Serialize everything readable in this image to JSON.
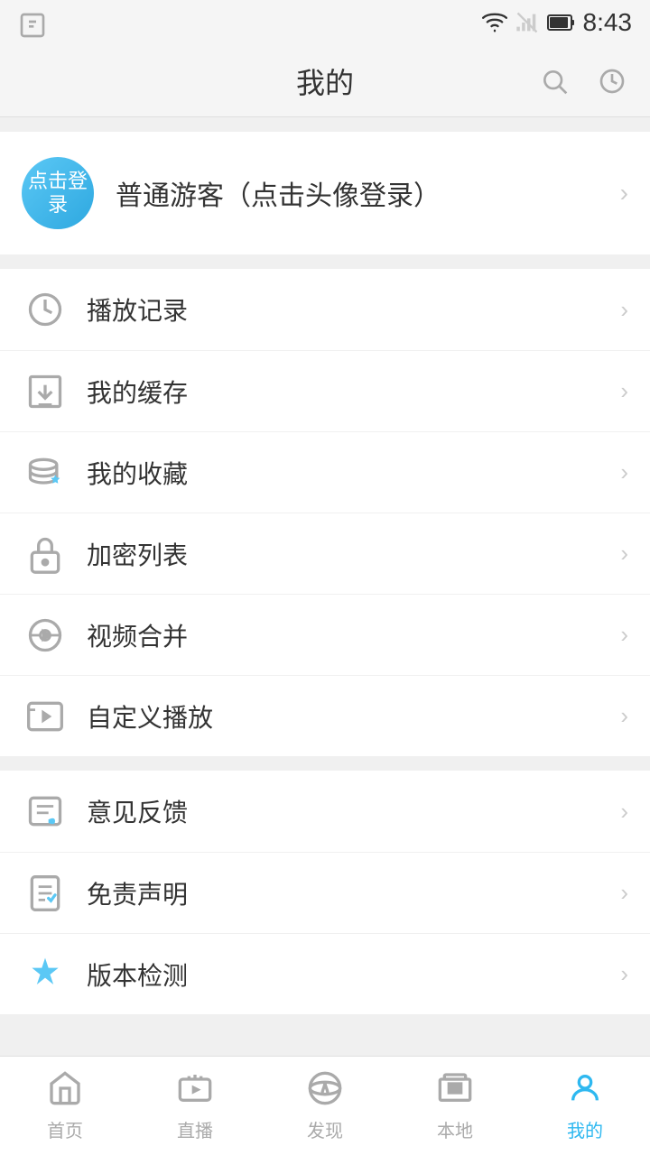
{
  "statusBar": {
    "time": "8:43",
    "wifiIcon": "wifi",
    "signalIcon": "signal",
    "batteryIcon": "battery"
  },
  "header": {
    "title": "我的",
    "searchLabel": "搜索",
    "historyLabel": "历史"
  },
  "profile": {
    "avatarText": "点击登录",
    "name": "普通游客（点击头像登录）"
  },
  "menuGroups": [
    {
      "id": "group1",
      "items": [
        {
          "id": "play-history",
          "icon": "clock",
          "label": "播放记录"
        },
        {
          "id": "my-cache",
          "icon": "download",
          "label": "我的缓存"
        },
        {
          "id": "my-favorites",
          "icon": "star-db",
          "label": "我的收藏"
        },
        {
          "id": "encrypted-list",
          "icon": "lock",
          "label": "加密列表"
        },
        {
          "id": "video-merge",
          "icon": "merge",
          "label": "视频合并"
        },
        {
          "id": "custom-play",
          "icon": "play-custom",
          "label": "自定义播放"
        }
      ]
    },
    {
      "id": "group2",
      "items": [
        {
          "id": "feedback",
          "icon": "feedback",
          "label": "意见反馈"
        },
        {
          "id": "disclaimer",
          "icon": "disclaimer",
          "label": "免责声明"
        },
        {
          "id": "version-check",
          "icon": "version",
          "label": "版本检测"
        }
      ]
    }
  ],
  "bottomNav": [
    {
      "id": "home",
      "icon": "house",
      "label": "首页",
      "active": false
    },
    {
      "id": "live",
      "icon": "video",
      "label": "直播",
      "active": false
    },
    {
      "id": "discover",
      "icon": "eye",
      "label": "发现",
      "active": false
    },
    {
      "id": "local",
      "icon": "layers",
      "label": "本地",
      "active": false
    },
    {
      "id": "mine",
      "icon": "user",
      "label": "我的",
      "active": true
    }
  ]
}
